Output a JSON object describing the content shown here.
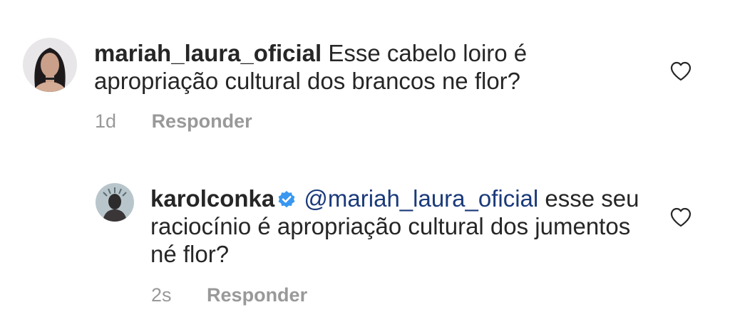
{
  "comments": [
    {
      "username": "mariah_laura_oficial",
      "text": "Esse cabelo loiro é apropriação cultural dos brancos ne flor?",
      "time": "1d",
      "reply_label": "Responder"
    },
    {
      "username": "karolconka",
      "mention": "@mariah_laura_oficial",
      "text": "esse seu raciocínio é apropriação cultural dos jumentos né flor?",
      "time": "2s",
      "reply_label": "Responder"
    }
  ],
  "icons": {
    "like": "heart-outline-icon",
    "verified": "verified-badge-icon"
  },
  "colors": {
    "text": "#262626",
    "secondary": "#999999",
    "mention": "#1a3a7a",
    "verified": "#3897f0"
  }
}
